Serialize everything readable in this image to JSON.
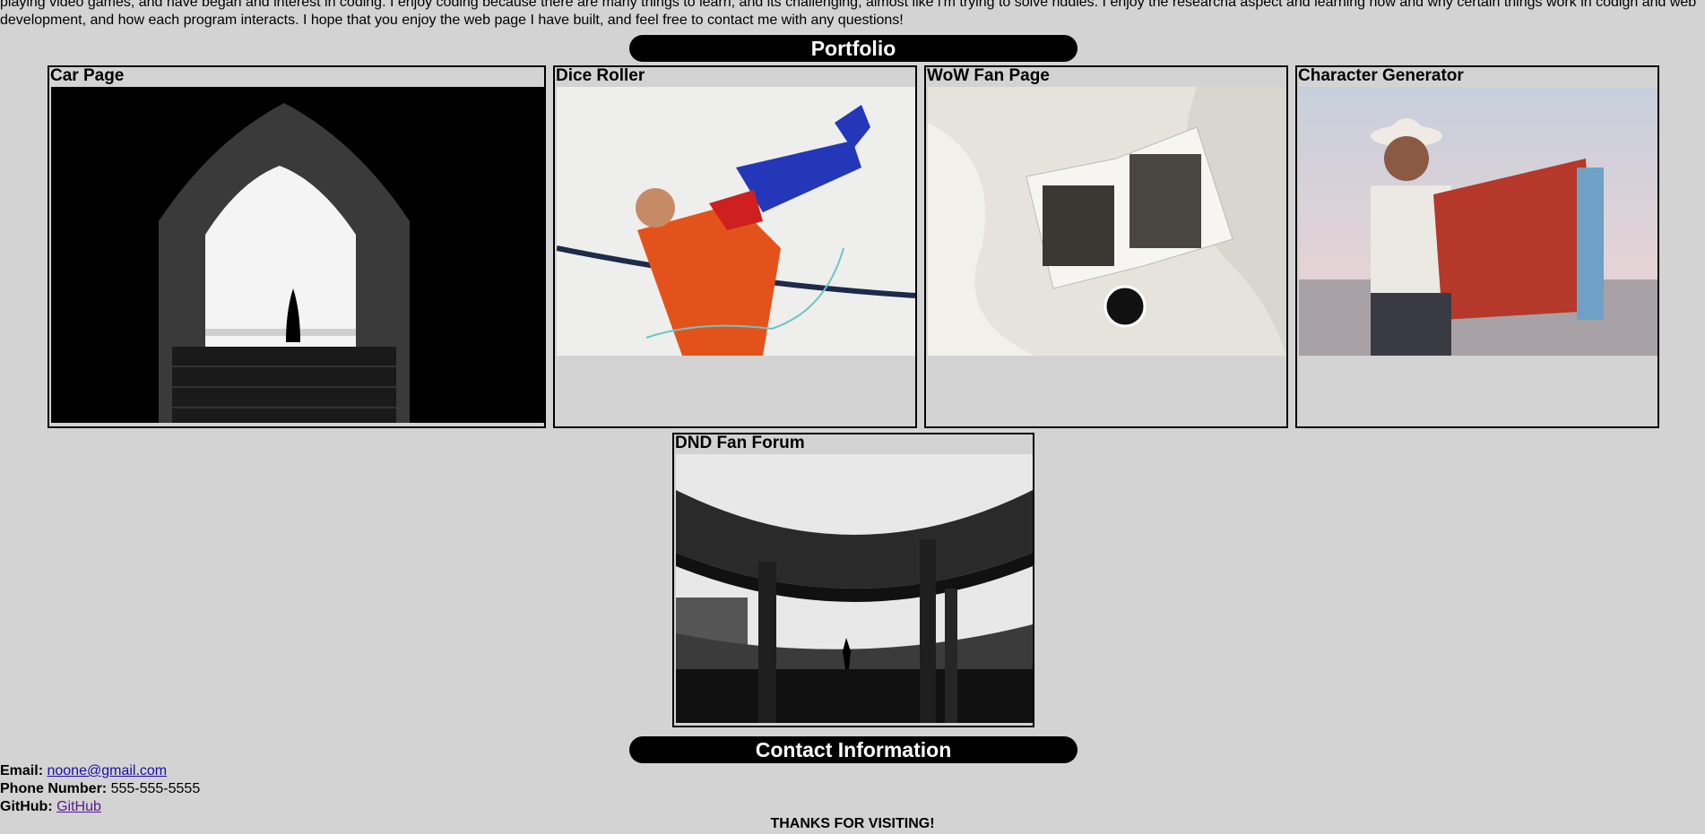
{
  "intro": {
    "text": "playing video games, and have began and interest in coding. I enjoy coding because there are many things to learn, and its challenging, almost like i'm trying to solve riddles. I enjoy the researcha aspect and learning how and why certain things work in codign and web development, and how each program interacts. I hope that you enjoy the web page I have built, and feel free to contact me with any questions!"
  },
  "portfolio": {
    "title": "Portfolio",
    "cards": [
      {
        "title": "Car Page"
      },
      {
        "title": "Dice Roller"
      },
      {
        "title": "WoW Fan Page"
      },
      {
        "title": "Character Generator"
      },
      {
        "title": "DND Fan Forum"
      }
    ]
  },
  "contact": {
    "title": "Contact Information",
    "email_label": "Email:",
    "email": "noone@gmail.com",
    "phone_label": "Phone Number:",
    "phone": "555-555-5555",
    "github_label": "GitHub:",
    "github": "GitHub"
  },
  "footer": {
    "thanks": "THANKS FOR VISITING!"
  }
}
